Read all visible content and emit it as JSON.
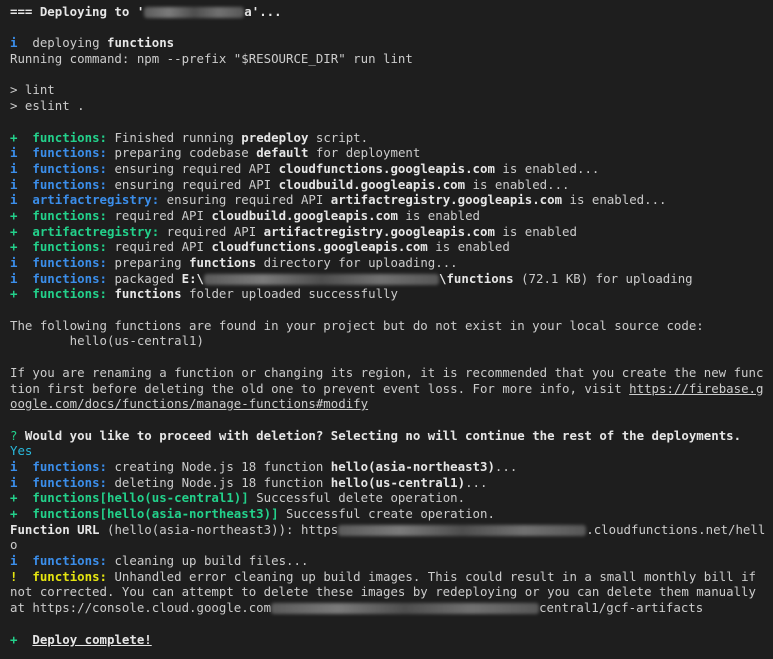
{
  "header": {
    "prefix": "=== Deploying to '",
    "suffix": "a'..."
  },
  "deploy_info": {
    "icon": "i",
    "text": "  deploying ",
    "target": "functions"
  },
  "run_command": "Running command: npm --prefix \"$RESOURCE_DIR\" run lint",
  "lint_lines": [
    "> lint",
    "> eslint ."
  ],
  "log": {
    "l1": {
      "icon": "+",
      "tag": "functions:",
      "a": " Finished running ",
      "b": "predeploy",
      "c": " script."
    },
    "l2": {
      "icon": "i",
      "tag": "functions:",
      "a": " preparing codebase ",
      "b": "default",
      "c": " for deployment"
    },
    "l3": {
      "icon": "i",
      "tag": "functions:",
      "a": " ensuring required API ",
      "b": "cloudfunctions.googleapis.com",
      "c": " is enabled..."
    },
    "l4": {
      "icon": "i",
      "tag": "functions:",
      "a": " ensuring required API ",
      "b": "cloudbuild.googleapis.com",
      "c": " is enabled..."
    },
    "l5": {
      "icon": "i",
      "tag": "artifactregistry:",
      "a": " ensuring required API ",
      "b": "artifactregistry.googleapis.com",
      "c": " is enabled..."
    },
    "l6": {
      "icon": "+",
      "tag": "functions:",
      "a": " required API ",
      "b": "cloudbuild.googleapis.com",
      "c": " is enabled"
    },
    "l7": {
      "icon": "+",
      "tag": "artifactregistry:",
      "a": " required API ",
      "b": "artifactregistry.googleapis.com",
      "c": " is enabled"
    },
    "l8": {
      "icon": "+",
      "tag": "functions:",
      "a": " required API ",
      "b": "cloudfunctions.googleapis.com",
      "c": " is enabled"
    },
    "l9": {
      "icon": "i",
      "tag": "functions:",
      "a": " preparing ",
      "b": "functions",
      "c": " directory for uploading..."
    },
    "l10": {
      "icon": "i",
      "tag": "functions:",
      "a": " packaged ",
      "b": "E:\\",
      "b2": "\\functions",
      "c": " (72.1 KB) for uploading"
    },
    "l11": {
      "icon": "+",
      "tag": "functions:",
      "a": " ",
      "b": "functions",
      "c": " folder uploaded successfully"
    }
  },
  "notice": {
    "line1": "The following functions are found in your project but do not exist in your local source code:",
    "line2": "        hello(us-central1)"
  },
  "rename_notice": {
    "line1": "If you are renaming a function or changing its region, it is recommended that you create the new func",
    "line2": "tion first before deleting the old one to prevent event loss. For more info, visit ",
    "link1": "https://firebase.g",
    "link2": "oogle.com/docs/functions/manage-functions#modify"
  },
  "prompt": {
    "mark": "?",
    "question": " Would you like to proceed with deletion? Selecting no will continue the rest of the deployments.",
    "answer": "Yes"
  },
  "ops": {
    "o1": {
      "icon": "i",
      "tag": "functions:",
      "a": " creating Node.js 18 function ",
      "b": "hello(asia-northeast3)",
      "c": "..."
    },
    "o2": {
      "icon": "i",
      "tag": "functions:",
      "a": " deleting Node.js 18 function ",
      "b": "hello(us-central1)",
      "c": "..."
    },
    "o3": {
      "icon": "+",
      "tag": "functions[hello(us-central1)]",
      "c": " Successful delete operation."
    },
    "o4": {
      "icon": "+",
      "tag": "functions[hello(asia-northeast3)]",
      "c": " Successful create operation."
    }
  },
  "function_url": {
    "label": "Function URL",
    "a": " (hello(asia-northeast3)): https",
    "b": ".cloudfunctions.net/hell",
    "wrap": "o"
  },
  "cleanup": {
    "c1": {
      "icon": "i",
      "tag": "functions:",
      "a": " cleaning up build files..."
    },
    "c2": {
      "icon": "!",
      "tag": "functions:",
      "a": " Unhandled error cleaning up build images. This could result in a small monthly bill if"
    },
    "line2": "not corrected. You can attempt to delete these images by redeploying or you can delete them manually",
    "line3a": "at https://console.cloud.google.com",
    "line3b": "central1/gcf-artifacts"
  },
  "complete": {
    "icon": "+",
    "text": "Deploy complete!"
  },
  "colors": {
    "background": "#1e1e1e",
    "info_blue": "#3b8eea",
    "success_green": "#23d18b",
    "warning_yellow": "#e5e510",
    "prompt_cyan": "#29b8db"
  }
}
